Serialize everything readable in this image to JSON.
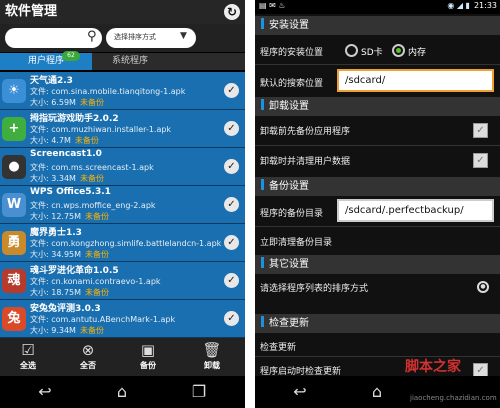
{
  "left": {
    "title": "软件管理",
    "sort_label": "选择排序方式",
    "tabs": [
      {
        "label": "用户程序",
        "badge": "62"
      },
      {
        "label": "系统程序"
      }
    ],
    "apps": [
      {
        "name": "天气通2.3",
        "file": "文件: com.sina.mobile.tianqitong-1.apk",
        "size": "大小: 6.59M",
        "flag": "未备份",
        "icon_color": "#3b8fd6",
        "icon_glyph": "☀"
      },
      {
        "name": "拇指玩游戏助手2.0.2",
        "file": "文件: com.muzhiwan.installer-1.apk",
        "size": "大小: 4.7M",
        "flag": "未备份",
        "icon_color": "#3fae3f",
        "icon_glyph": "+"
      },
      {
        "name": "Screencast1.0",
        "file": "文件: com.ms.screencast-1.apk",
        "size": "大小: 3.34M",
        "flag": "未备份",
        "icon_color": "#333333",
        "icon_glyph": "●"
      },
      {
        "name": "WPS Office5.3.1",
        "file": "文件: cn.wps.moffice_eng-2.apk",
        "size": "大小: 12.75M",
        "flag": "未备份",
        "icon_color": "#4a8fcf",
        "icon_glyph": "W"
      },
      {
        "name": "魔界勇士1.3",
        "file": "文件: com.kongzhong.simlife.battlelandcn-1.apk",
        "size": "大小: 34.95M",
        "flag": "未备份",
        "icon_color": "#c88a2a",
        "icon_glyph": "勇"
      },
      {
        "name": "魂斗罗进化革命1.0.5",
        "file": "文件: cn.konami.contraevo-1.apk",
        "size": "大小: 18.75M",
        "flag": "未备份",
        "icon_color": "#b83a2a",
        "icon_glyph": "魂"
      },
      {
        "name": "安兔兔评测3.0.3",
        "file": "文件: com.antutu.ABenchMark-1.apk",
        "size": "大小: 9.34M",
        "flag": "未备份",
        "icon_color": "#d84a2a",
        "icon_glyph": "兔"
      }
    ],
    "actions": [
      {
        "label": "全选",
        "icon": "check-square-icon",
        "glyph": "☑"
      },
      {
        "label": "全否",
        "icon": "cancel-circle-icon",
        "glyph": "⊗"
      },
      {
        "label": "备份",
        "icon": "save-icon",
        "glyph": "▣"
      },
      {
        "label": "卸载",
        "icon": "trash-icon",
        "glyph": "🗑"
      }
    ],
    "nav_icons": [
      "back-icon",
      "home-icon",
      "recent-apps-icon"
    ]
  },
  "right": {
    "status_time": "21:33",
    "sections": {
      "install": "安装设置",
      "uninstall": "卸载设置",
      "backup": "备份设置",
      "other": "其它设置",
      "update": "检查更新"
    },
    "install_location_label": "程序的安装位置",
    "opt_sd": "SD卡",
    "opt_internal": "内存",
    "selected_option": "内存",
    "default_search_label": "默认的搜索位置",
    "default_search_value": "/sdcard/",
    "backup_before_uninstall": "卸载前先备份应用程序",
    "clear_data_on_uninstall": "卸载时并清理用户数据",
    "backup_dir_label": "程序的备份目录",
    "backup_dir_value": "/sdcard/.perfectbackup/",
    "clear_backup": "立即清理备份目录",
    "sort_order": "请选择程序列表的排序方式",
    "check_update": "检查更新",
    "check_on_start": "程序启动时检查更新",
    "watermark": "脚本之家",
    "watermark_url": "jiaocheng.chazidian.com"
  },
  "colors": {
    "accent": "#1e90e0",
    "list_blue": "#1a6fb0",
    "flag": "#ffb400",
    "radio_on": "#5dc228",
    "field_border": "#f0a030"
  }
}
